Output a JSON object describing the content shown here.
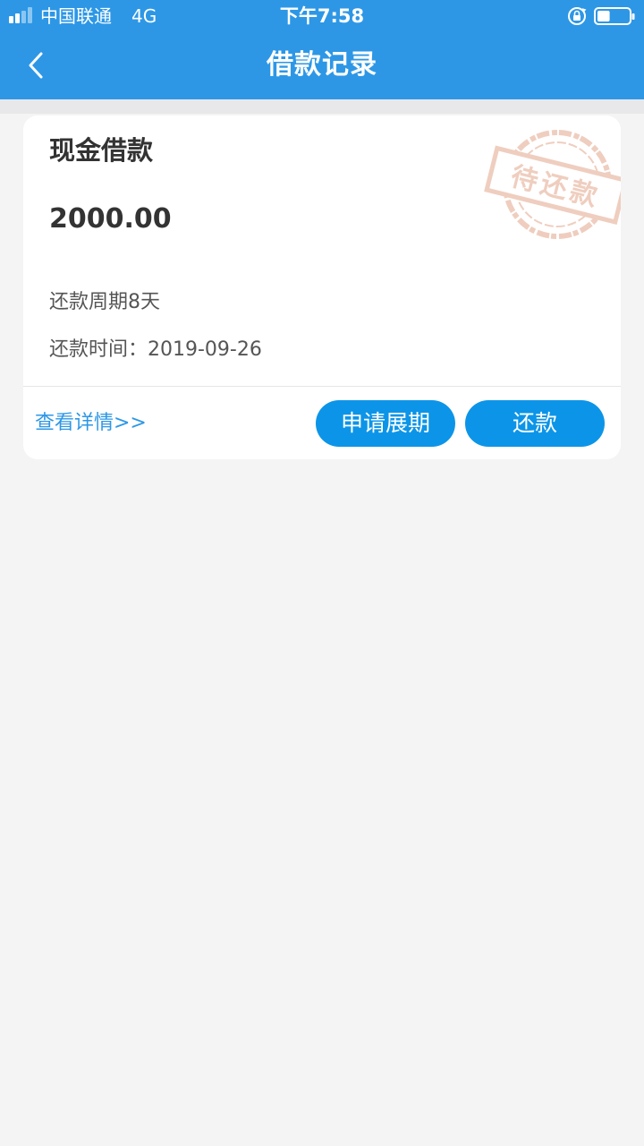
{
  "status_bar": {
    "carrier": "中国联通",
    "network": "4G",
    "time": "下午7:58",
    "battery_level": 0.4
  },
  "header": {
    "title": "借款记录",
    "background": "#2d97e6"
  },
  "loan_card": {
    "type": "现金借款",
    "amount": "2000.00",
    "period": "还款周期8天",
    "due_date": "还款时间：2019-09-26",
    "stamp_text": "待还款",
    "detail_link": "查看详情>>",
    "extend_button": "申请展期",
    "repay_button": "还款",
    "accent": "#0c95e8"
  }
}
